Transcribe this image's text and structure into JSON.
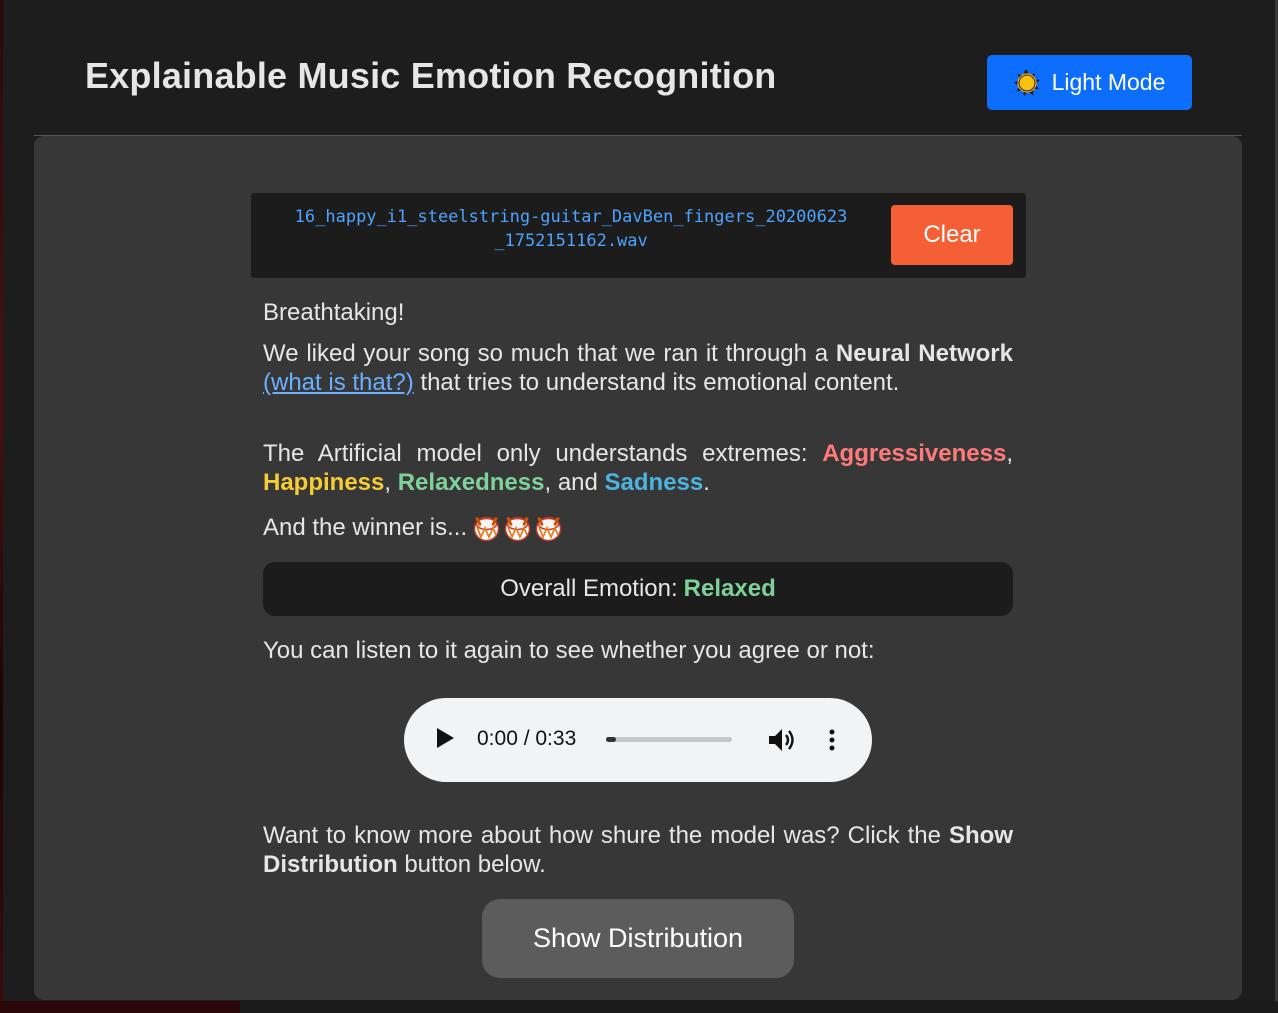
{
  "header": {
    "title": "Explainable Music Emotion Recognition",
    "mode_button_label": "Light Mode"
  },
  "file": {
    "name": "16_happy_i1_steelstring-guitar_DavBen_fingers_20200623_1752151162.wav",
    "clear_label": "Clear"
  },
  "content": {
    "exclaim": "Breathtaking!",
    "p1_a": "We liked your song so much that we ran it through a ",
    "p1_bold": "Neural Network",
    "p1_link": "(what is that?)",
    "p1_b": " that tries to understand its emotional content.",
    "p2_a": "The Artificial model only understands extremes: ",
    "emotion_aggressiveness": "Aggressiveness",
    "emotion_happiness": "Happiness",
    "emotion_relaxedness": "Relaxedness",
    "emotion_sadness": "Sadness",
    "winner_text": "And the winner is...",
    "overall_label": "Overall Emotion:",
    "overall_value": "Relaxed",
    "listen_text": "You can listen to it again to see whether you agree or not:",
    "p3_a": "Want to know more about how shure the model was? Click the ",
    "p3_bold": "Show Distribution",
    "p3_b": " button below.",
    "show_button_label": "Show Distribution"
  },
  "audio": {
    "time": "0:00 / 0:33",
    "progress": 0
  },
  "colors": {
    "accent_blue": "#0d6efd",
    "clear_orange": "#f55f35",
    "aggressiveness": "#ff7b7b",
    "happiness": "#f3cc36",
    "relaxedness": "#7fd19a",
    "sadness": "#4db3e0"
  },
  "icons": {
    "mode": "sun-icon",
    "winner": "drum-icon"
  }
}
